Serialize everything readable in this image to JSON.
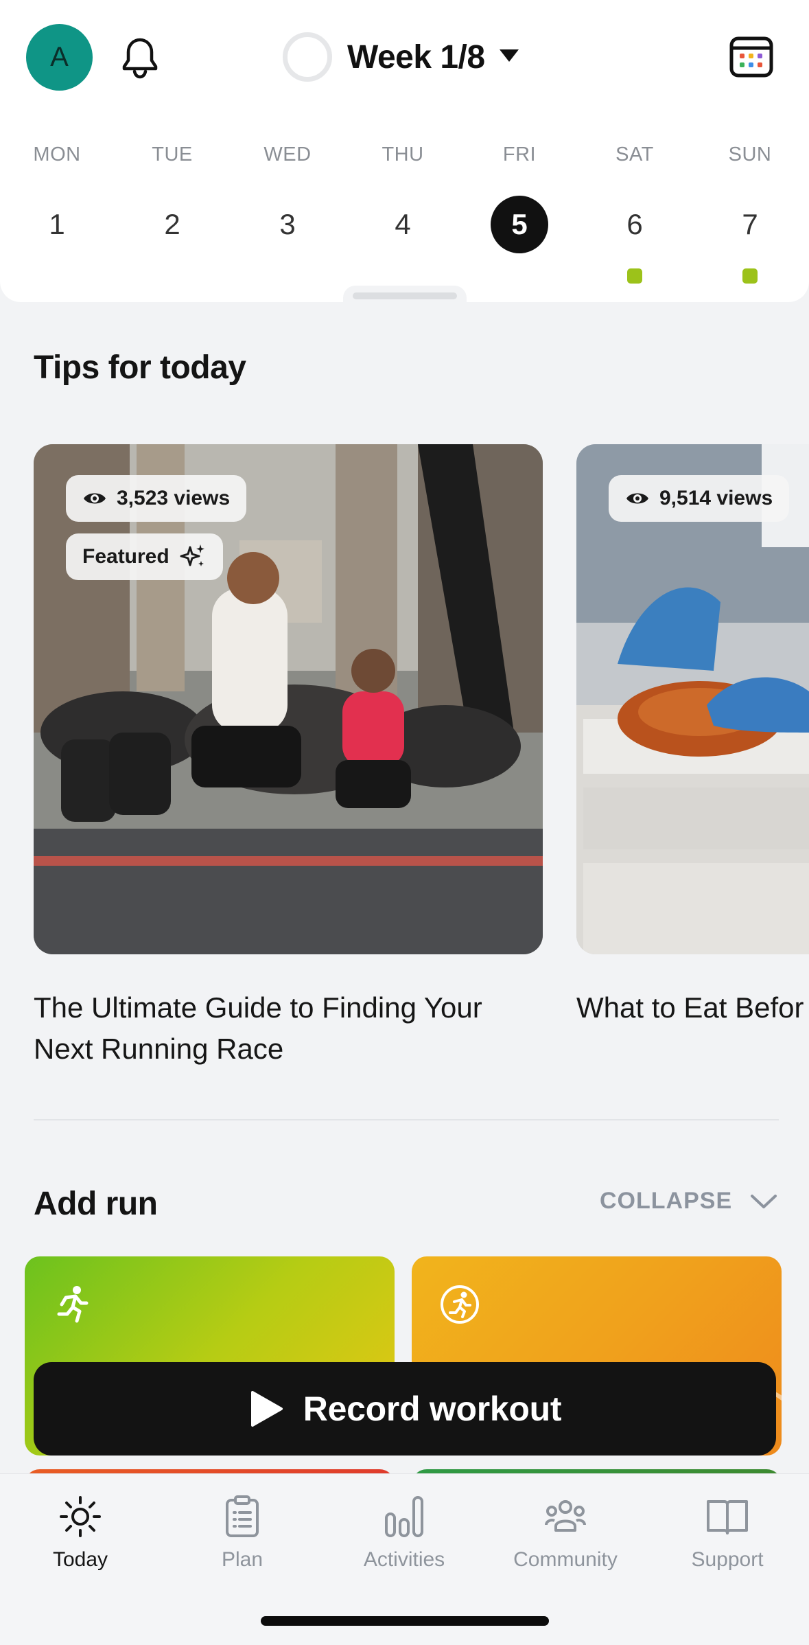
{
  "header": {
    "avatar_initial": "A",
    "week_label": "Week 1/8"
  },
  "days": [
    {
      "name": "MON",
      "num": "1",
      "active": false,
      "has_workout": false
    },
    {
      "name": "TUE",
      "num": "2",
      "active": false,
      "has_workout": false
    },
    {
      "name": "WED",
      "num": "3",
      "active": false,
      "has_workout": false
    },
    {
      "name": "THU",
      "num": "4",
      "active": false,
      "has_workout": false
    },
    {
      "name": "FRI",
      "num": "5",
      "active": true,
      "has_workout": false
    },
    {
      "name": "SAT",
      "num": "6",
      "active": false,
      "has_workout": true
    },
    {
      "name": "SUN",
      "num": "7",
      "active": false,
      "has_workout": true
    }
  ],
  "tips": {
    "section_title": "Tips for today",
    "cards": [
      {
        "views": "3,523 views",
        "badge": "Featured",
        "title": "The Ultimate Guide to Finding Your Next Running Race"
      },
      {
        "views": "9,514 views",
        "badge": "",
        "title": "What to Eat Befor"
      }
    ]
  },
  "add_run": {
    "section_title": "Add run",
    "collapse_label": "COLLAPSE"
  },
  "record_button": {
    "label": "Record workout"
  },
  "nav": [
    {
      "label": "Today",
      "icon": "sun-icon",
      "active": true
    },
    {
      "label": "Plan",
      "icon": "clipboard-icon",
      "active": false
    },
    {
      "label": "Activities",
      "icon": "bar-chart-icon",
      "active": false
    },
    {
      "label": "Community",
      "icon": "people-icon",
      "active": false
    },
    {
      "label": "Support",
      "icon": "book-icon",
      "active": false
    }
  ],
  "colors": {
    "accent_teal": "#0f9586",
    "workout_dot": "#9cc21a",
    "dark": "#131313"
  }
}
